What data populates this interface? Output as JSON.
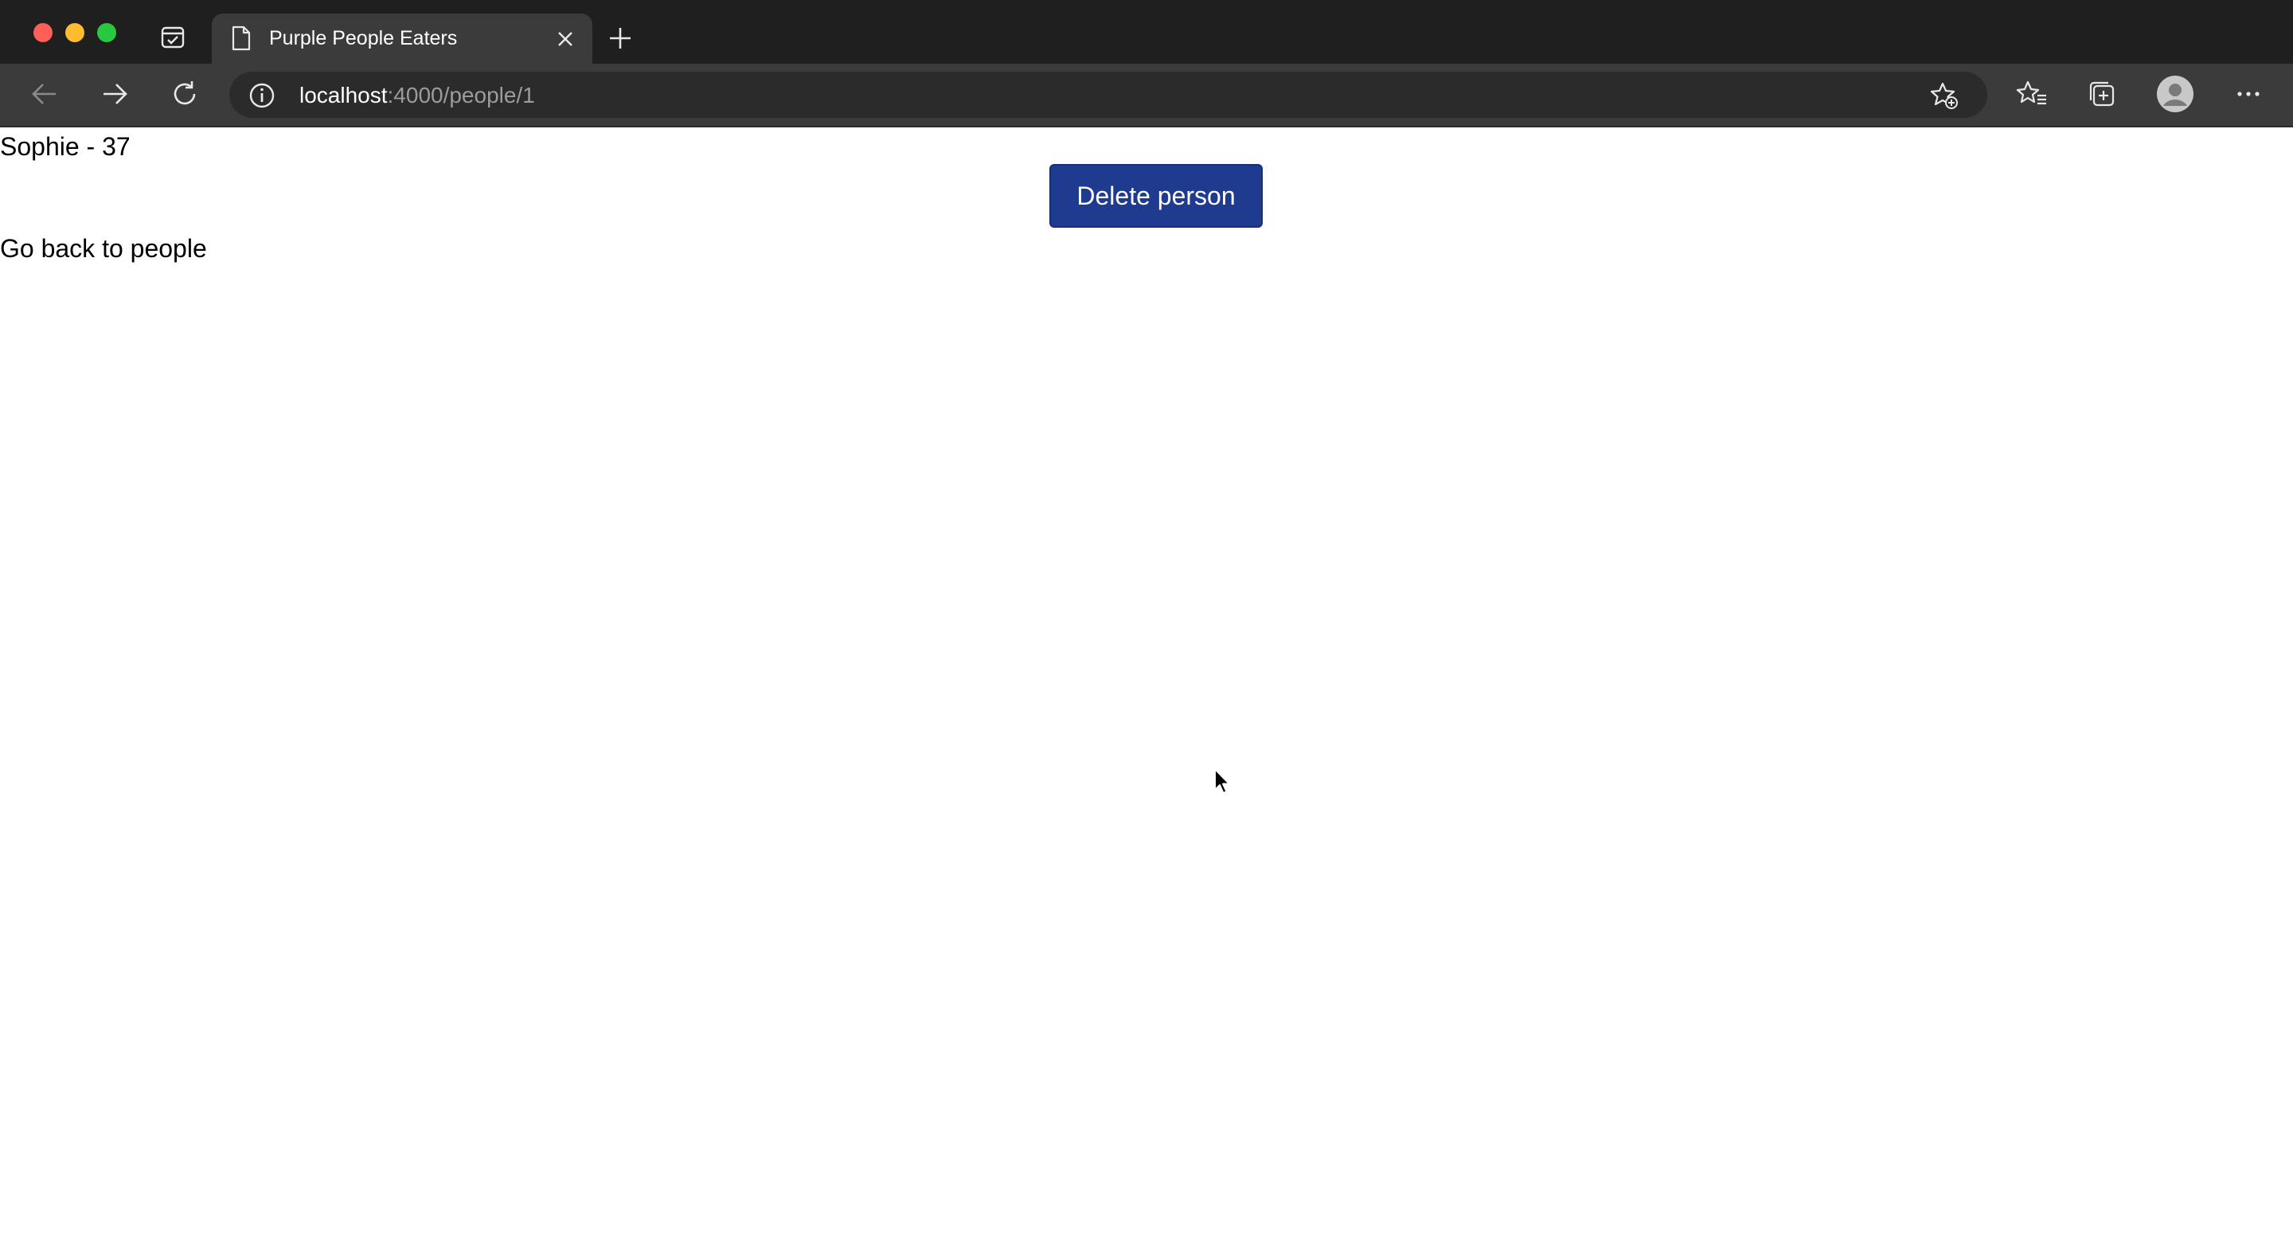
{
  "browser": {
    "tab": {
      "title": "Purple People Eaters"
    },
    "address_bar": {
      "host": "localhost",
      "path": ":4000/people/1"
    },
    "icons": {
      "close": "close-icon",
      "new_tab": "plus-icon",
      "back": "arrow-left-icon",
      "forward": "arrow-right-icon",
      "refresh": "refresh-icon",
      "info": "info-icon",
      "add_favorite": "star-add-icon",
      "favorites": "favorites-icon",
      "collections": "collections-icon",
      "profile": "profile-icon",
      "more": "more-icon"
    }
  },
  "page": {
    "person_info": "Sophie - 37",
    "delete_button_label": "Delete person",
    "back_link_label": "Go back to people"
  },
  "colors": {
    "button_background": "#1f3b8f",
    "tabstrip": "#1f1f1f",
    "toolbar": "#3b3b3b"
  }
}
